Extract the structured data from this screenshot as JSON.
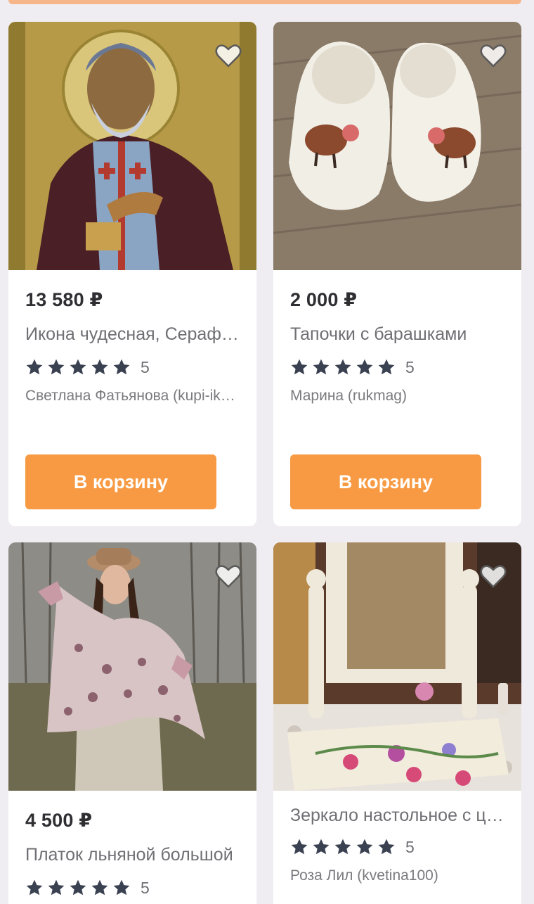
{
  "products": [
    {
      "price": "13 580 ₽",
      "title": "Икона чудесная, Серафим Саровский",
      "rating_value": 5,
      "rating_text": "5",
      "seller": "Светлана Фатьянова (kupi-ikonu)",
      "cart_label": "В корзину",
      "image": "icon-saint"
    },
    {
      "price": "2 000 ₽",
      "title": "Тапочки с барашками",
      "rating_value": 5,
      "rating_text": "5",
      "seller": "Марина (rukmag)",
      "cart_label": "В корзину",
      "image": "felt-slippers"
    },
    {
      "price": "4 500 ₽",
      "title": "Платок льняной большой",
      "rating_value": 5,
      "rating_text": "5",
      "image": "linen-shawl"
    },
    {
      "title": "Зеркало настольное с цветами",
      "rating_value": 5,
      "rating_text": "5",
      "seller": "Роза Лил (kvetina100)",
      "image": "table-mirror"
    }
  ],
  "colors": {
    "accent": "#f79a43",
    "star": "#3a4150",
    "background": "#efedf1"
  }
}
